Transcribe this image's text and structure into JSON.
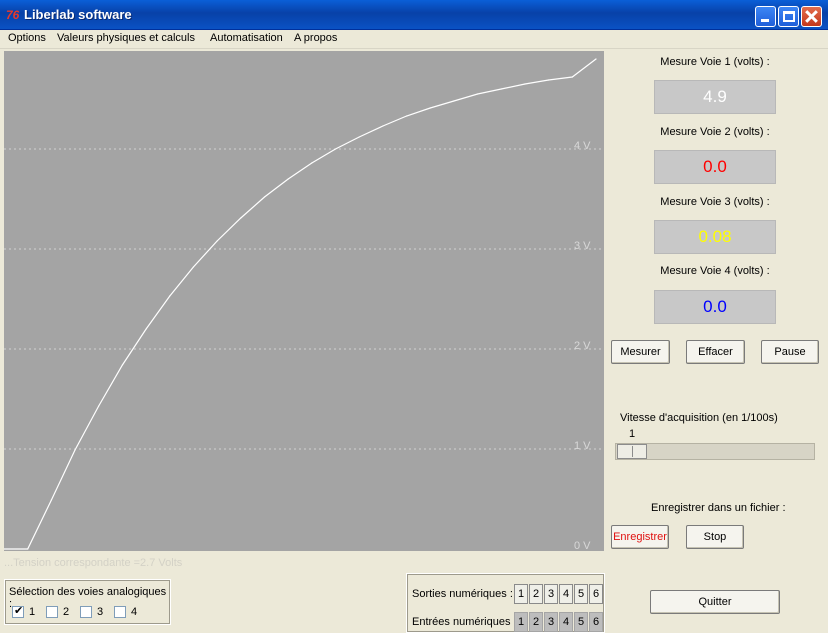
{
  "window": {
    "title": "Liberlab software",
    "icon_text": "76"
  },
  "menu": [
    "Options",
    "Valeurs physiques  et calculs",
    "Automatisation",
    "A propos"
  ],
  "plot": {
    "y_labels": [
      "4 V",
      "3 V",
      "2 V",
      "1 V",
      "0 V"
    ],
    "background": "#a4a4a4",
    "line_color": "#ffffff"
  },
  "chart_data": {
    "type": "line",
    "ylim": [
      0,
      5
    ],
    "x": [
      0,
      5,
      10,
      15,
      20,
      25,
      30,
      35,
      40,
      45,
      50,
      55,
      60,
      65,
      70,
      75,
      80,
      85,
      90,
      95,
      100,
      105,
      110,
      115,
      120,
      125
    ],
    "series": [
      {
        "values": [
          0,
          0,
          0.49,
          0.99,
          1.43,
          1.84,
          2.2,
          2.53,
          2.82,
          3.08,
          3.31,
          3.52,
          3.7,
          3.86,
          4.0,
          4.12,
          4.23,
          4.33,
          4.41,
          4.48,
          4.55,
          4.6,
          4.65,
          4.69,
          4.72,
          4.9
        ]
      }
    ]
  },
  "tension_text": "...Tension correspondante =2.7 Volts",
  "measures": [
    {
      "label": "Mesure Voie 1 (volts) :",
      "value": "4.9",
      "color": "#ffffff"
    },
    {
      "label": "Mesure Voie 2  (volts) :",
      "value": "0.0",
      "color": "#ff0000"
    },
    {
      "label": "Mesure Voie 3  (volts) :",
      "value": "0.08",
      "color": "#ffff00"
    },
    {
      "label": "Mesure Voie 4  (volts) :",
      "value": "0.0",
      "color": "#0000ff"
    }
  ],
  "buttons": {
    "mesurer": "Mesurer",
    "effacer": "Effacer",
    "pause": "Pause",
    "enregistrer": "Enregistrer",
    "stop": "Stop",
    "quitter": "Quitter"
  },
  "speed": {
    "label": "Vitesse d'acquisition (en 1/100s)",
    "value": "1"
  },
  "save_label": "Enregistrer dans un fichier :",
  "channels": {
    "title": "Sélection des voies analogiques :",
    "items": [
      {
        "label": "1",
        "checked": true
      },
      {
        "label": "2",
        "checked": false
      },
      {
        "label": "3",
        "checked": false
      },
      {
        "label": "4",
        "checked": false
      }
    ]
  },
  "numeric": {
    "outputs_label": "Sorties numériques  :",
    "inputs_label": "Entrées numériques :",
    "outputs": [
      "1",
      "2",
      "3",
      "4",
      "5",
      "6"
    ],
    "inputs": [
      "1",
      "2",
      "3",
      "4",
      "5",
      "6"
    ]
  }
}
